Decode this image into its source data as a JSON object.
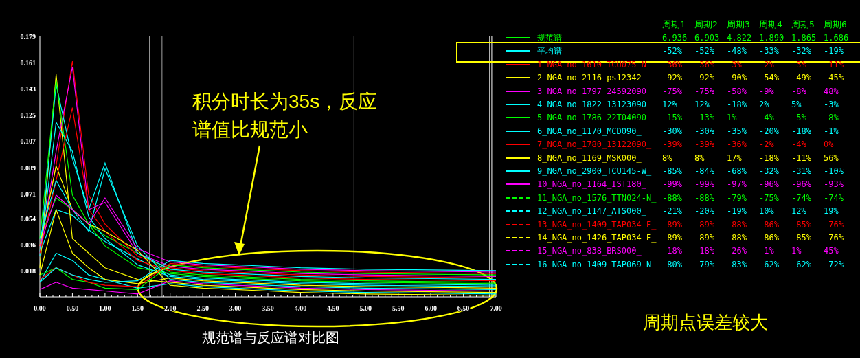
{
  "chart": {
    "title": "规范谱与反应谱对比图",
    "chart_data": {
      "type": "line",
      "x": [
        0,
        0.25,
        0.5,
        0.75,
        1,
        1.5,
        2,
        2.5,
        3,
        3.5,
        4,
        5,
        6,
        7
      ],
      "xlim": [
        0,
        7
      ],
      "ylim": [
        0,
        0.179
      ],
      "xticks": [
        {
          "value": 0,
          "label": "0.00"
        },
        {
          "value": 0.5,
          "label": "0.50"
        },
        {
          "value": 1,
          "label": "1.00"
        },
        {
          "value": 1.5,
          "label": "1.50"
        },
        {
          "value": 2,
          "label": "2.00"
        },
        {
          "value": 2.5,
          "label": "2.50"
        },
        {
          "value": 3,
          "label": "3.00"
        },
        {
          "value": 3.5,
          "label": "3.50"
        },
        {
          "value": 4,
          "label": "4.00"
        },
        {
          "value": 4.5,
          "label": "4.50"
        },
        {
          "value": 5,
          "label": "5.00"
        },
        {
          "value": 5.5,
          "label": "5.50"
        },
        {
          "value": 6,
          "label": "6.00"
        },
        {
          "value": 6.5,
          "label": "6.50"
        },
        {
          "value": 7,
          "label": "7.00"
        }
      ],
      "yticks": [
        {
          "value": 0.018,
          "label": "0.018"
        },
        {
          "value": 0.036,
          "label": "0.036"
        },
        {
          "value": 0.054,
          "label": "0.054"
        },
        {
          "value": 0.071,
          "label": "0.071"
        },
        {
          "value": 0.089,
          "label": "0.089"
        },
        {
          "value": 0.107,
          "label": "0.107"
        },
        {
          "value": 0.125,
          "label": "0.125"
        },
        {
          "value": 0.143,
          "label": "0.143"
        },
        {
          "value": 0.161,
          "label": "0.161"
        },
        {
          "value": 0.179,
          "label": "0.179"
        }
      ],
      "series": [
        {
          "color": "#00ff00",
          "values": [
            0.04,
            0.068,
            0.06,
            0.05,
            0.042,
            0.03,
            0.017,
            0.015,
            0.014,
            0.013,
            0.012,
            0.011,
            0.0105,
            0.01
          ]
        },
        {
          "color": "#00ffff",
          "values": [
            0.03,
            0.06,
            0.056,
            0.046,
            0.038,
            0.026,
            0.015,
            0.013,
            0.012,
            0.011,
            0.01,
            0.009,
            0.0085,
            0.008
          ]
        },
        {
          "color": "#ff0000",
          "values": [
            0.035,
            0.09,
            0.162,
            0.07,
            0.05,
            0.028,
            0.02,
            0.018,
            0.017,
            0.016,
            0.015,
            0.014,
            0.0135,
            0.013
          ]
        },
        {
          "color": "#ffff00",
          "values": [
            0.02,
            0.153,
            0.04,
            0.03,
            0.02,
            0.012,
            0.01,
            0.008,
            0.007,
            0.006,
            0.005,
            0.004,
            0.0035,
            0.003
          ]
        },
        {
          "color": "#ff00ff",
          "values": [
            0.03,
            0.1,
            0.158,
            0.06,
            0.065,
            0.03,
            0.021,
            0.019,
            0.018,
            0.017,
            0.016,
            0.015,
            0.0145,
            0.014
          ]
        },
        {
          "color": "#00ffff",
          "values": [
            0.03,
            0.146,
            0.095,
            0.06,
            0.092,
            0.03,
            0.019,
            0.017,
            0.016,
            0.015,
            0.014,
            0.013,
            0.0125,
            0.012
          ]
        },
        {
          "color": "#00ff00",
          "values": [
            0.04,
            0.149,
            0.07,
            0.05,
            0.035,
            0.02,
            0.016,
            0.014,
            0.013,
            0.012,
            0.011,
            0.01,
            0.0095,
            0.009
          ]
        },
        {
          "color": "#00ffff",
          "values": [
            0.028,
            0.12,
            0.1,
            0.055,
            0.04,
            0.022,
            0.014,
            0.012,
            0.011,
            0.01,
            0.009,
            0.008,
            0.0075,
            0.007
          ]
        },
        {
          "color": "#ff0000",
          "values": [
            0.03,
            0.08,
            0.13,
            0.06,
            0.045,
            0.025,
            0.018,
            0.016,
            0.015,
            0.014,
            0.013,
            0.012,
            0.0115,
            0.011
          ]
        },
        {
          "color": "#ffff00",
          "values": [
            0.035,
            0.09,
            0.06,
            0.05,
            0.045,
            0.032,
            0.008,
            0.006,
            0.005,
            0.004,
            0.003,
            0.002,
            0.0015,
            0.001
          ]
        },
        {
          "color": "#00ffff",
          "values": [
            0.01,
            0.03,
            0.025,
            0.015,
            0.012,
            0.006,
            0.009,
            0.007,
            0.006,
            0.005,
            0.004,
            0.003,
            0.0025,
            0.002
          ]
        },
        {
          "color": "#ff00ff",
          "values": [
            0.005,
            0.01,
            0.006,
            0.005,
            0.004,
            0.002,
            0.011,
            0.009,
            0.008,
            0.007,
            0.006,
            0.005,
            0.0045,
            0.004
          ]
        },
        {
          "color": "#00ff00",
          "values": [
            0.015,
            0.02,
            0.012,
            0.01,
            0.006,
            0.005,
            0.022,
            0.02,
            0.019,
            0.018,
            0.017,
            0.016,
            0.0155,
            0.015
          ]
        },
        {
          "color": "#00ffff",
          "values": [
            0.04,
            0.08,
            0.06,
            0.045,
            0.088,
            0.035,
            0.012,
            0.01,
            0.009,
            0.008,
            0.007,
            0.006,
            0.0055,
            0.005
          ]
        },
        {
          "color": "#ff0000",
          "values": [
            0.012,
            0.02,
            0.015,
            0.01,
            0.008,
            0.007,
            0.023,
            0.021,
            0.02,
            0.019,
            0.018,
            0.017,
            0.0165,
            0.016
          ]
        },
        {
          "color": "#ffff00",
          "values": [
            0.015,
            0.06,
            0.03,
            0.02,
            0.012,
            0.009,
            0.013,
            0.011,
            0.01,
            0.009,
            0.008,
            0.007,
            0.0065,
            0.006
          ]
        },
        {
          "color": "#ff00ff",
          "values": [
            0.035,
            0.07,
            0.06,
            0.05,
            0.068,
            0.033,
            0.024,
            0.022,
            0.021,
            0.02,
            0.019,
            0.018,
            0.0175,
            0.017
          ]
        },
        {
          "color": "#00ffff",
          "values": [
            0.01,
            0.02,
            0.015,
            0.012,
            0.01,
            0.011,
            0.025,
            0.023,
            0.022,
            0.021,
            0.02,
            0.019,
            0.0185,
            0.018
          ]
        }
      ]
    }
  },
  "callout": {
    "text": "积分时长为35s，反应谱值比规范小"
  },
  "table": {
    "columns": [
      "周期1",
      "周期2",
      "周期3",
      "周期4",
      "周期5",
      "周期6"
    ],
    "rows": [
      {
        "name": "规范谱",
        "color": "#00ff00",
        "dashed": false,
        "highlighted": false,
        "values": [
          "6.936",
          "6.903",
          "4.822",
          "1.890",
          "1.865",
          "1.686"
        ]
      },
      {
        "name": "平均谱",
        "color": "#00ffff",
        "dashed": false,
        "highlighted": true,
        "values": [
          "-52%",
          "-52%",
          "-48%",
          "-33%",
          "-32%",
          "-19%"
        ]
      },
      {
        "name": "1_NGA_no_1610_TCU075-N_",
        "color": "#ff0000",
        "dashed": false,
        "highlighted": false,
        "values": [
          "-36%",
          "-36%",
          "-3%",
          "-2%",
          "-3%",
          "-11%"
        ]
      },
      {
        "name": "2_NGA_no_2116_ps12342_",
        "color": "#ffff00",
        "dashed": false,
        "highlighted": false,
        "values": [
          "-92%",
          "-92%",
          "-90%",
          "-54%",
          "-49%",
          "-45%"
        ]
      },
      {
        "name": "3_NGA_no_1797_24592090_",
        "color": "#ff00ff",
        "dashed": false,
        "highlighted": false,
        "values": [
          "-75%",
          "-75%",
          "-58%",
          "-9%",
          "-8%",
          "48%"
        ]
      },
      {
        "name": "4_NGA_no_1822_13123090_",
        "color": "#00ffff",
        "dashed": false,
        "highlighted": false,
        "values": [
          "12%",
          "12%",
          "-18%",
          "2%",
          "5%",
          "-3%"
        ]
      },
      {
        "name": "5_NGA_no_1786_22T04090_",
        "color": "#00ff00",
        "dashed": false,
        "highlighted": false,
        "values": [
          "-15%",
          "-13%",
          "1%",
          "-4%",
          "-5%",
          "-8%"
        ]
      },
      {
        "name": "6_NGA_no_1170_MCD090_",
        "color": "#00ffff",
        "dashed": false,
        "highlighted": false,
        "values": [
          "-30%",
          "-30%",
          "-35%",
          "-20%",
          "-18%",
          "-1%"
        ]
      },
      {
        "name": "7_NGA_no_1780_13122090_",
        "color": "#ff0000",
        "dashed": false,
        "highlighted": false,
        "values": [
          "-39%",
          "-39%",
          "-36%",
          "-2%",
          "-4%",
          "0%"
        ]
      },
      {
        "name": "8_NGA_no_1169_MSK000_",
        "color": "#ffff00",
        "dashed": false,
        "highlighted": false,
        "values": [
          "8%",
          "8%",
          "17%",
          "-18%",
          "-11%",
          "56%"
        ]
      },
      {
        "name": "9_NGA_no_2900_TCU145-W_",
        "color": "#00ffff",
        "dashed": false,
        "highlighted": false,
        "values": [
          "-85%",
          "-84%",
          "-68%",
          "-32%",
          "-31%",
          "-10%"
        ]
      },
      {
        "name": "10_NGA_no_1164_IST180_",
        "color": "#ff00ff",
        "dashed": false,
        "highlighted": false,
        "values": [
          "-99%",
          "-99%",
          "-97%",
          "-96%",
          "-96%",
          "-93%"
        ]
      },
      {
        "name": "11_NGA_no_1576_TTN024-N_",
        "color": "#00ff00",
        "dashed": true,
        "highlighted": false,
        "values": [
          "-88%",
          "-88%",
          "-79%",
          "-75%",
          "-74%",
          "-74%"
        ]
      },
      {
        "name": "12_NGA_no_1147_ATS000_",
        "color": "#00ffff",
        "dashed": true,
        "highlighted": false,
        "values": [
          "-21%",
          "-20%",
          "-19%",
          "10%",
          "12%",
          "19%"
        ]
      },
      {
        "name": "13_NGA_no_1409_TAP034-E_",
        "color": "#ff0000",
        "dashed": true,
        "highlighted": false,
        "values": [
          "-89%",
          "-89%",
          "-88%",
          "-86%",
          "-85%",
          "-76%"
        ]
      },
      {
        "name": "14_NGA_no_1426_TAP034-E_",
        "color": "#ffff00",
        "dashed": true,
        "highlighted": false,
        "values": [
          "-89%",
          "-89%",
          "-88%",
          "-86%",
          "-85%",
          "-76%"
        ]
      },
      {
        "name": "15_NGA_no_838_BRS000_",
        "color": "#ff00ff",
        "dashed": true,
        "highlighted": false,
        "values": [
          "-18%",
          "-18%",
          "-26%",
          "-1%",
          "1%",
          "45%"
        ]
      },
      {
        "name": "16_NGA_no_1409_TAP069-N_",
        "color": "#00ffff",
        "dashed": true,
        "highlighted": false,
        "values": [
          "-80%",
          "-79%",
          "-83%",
          "-62%",
          "-62%",
          "-72%"
        ]
      }
    ]
  },
  "note": {
    "text": "周期点误差较大"
  }
}
